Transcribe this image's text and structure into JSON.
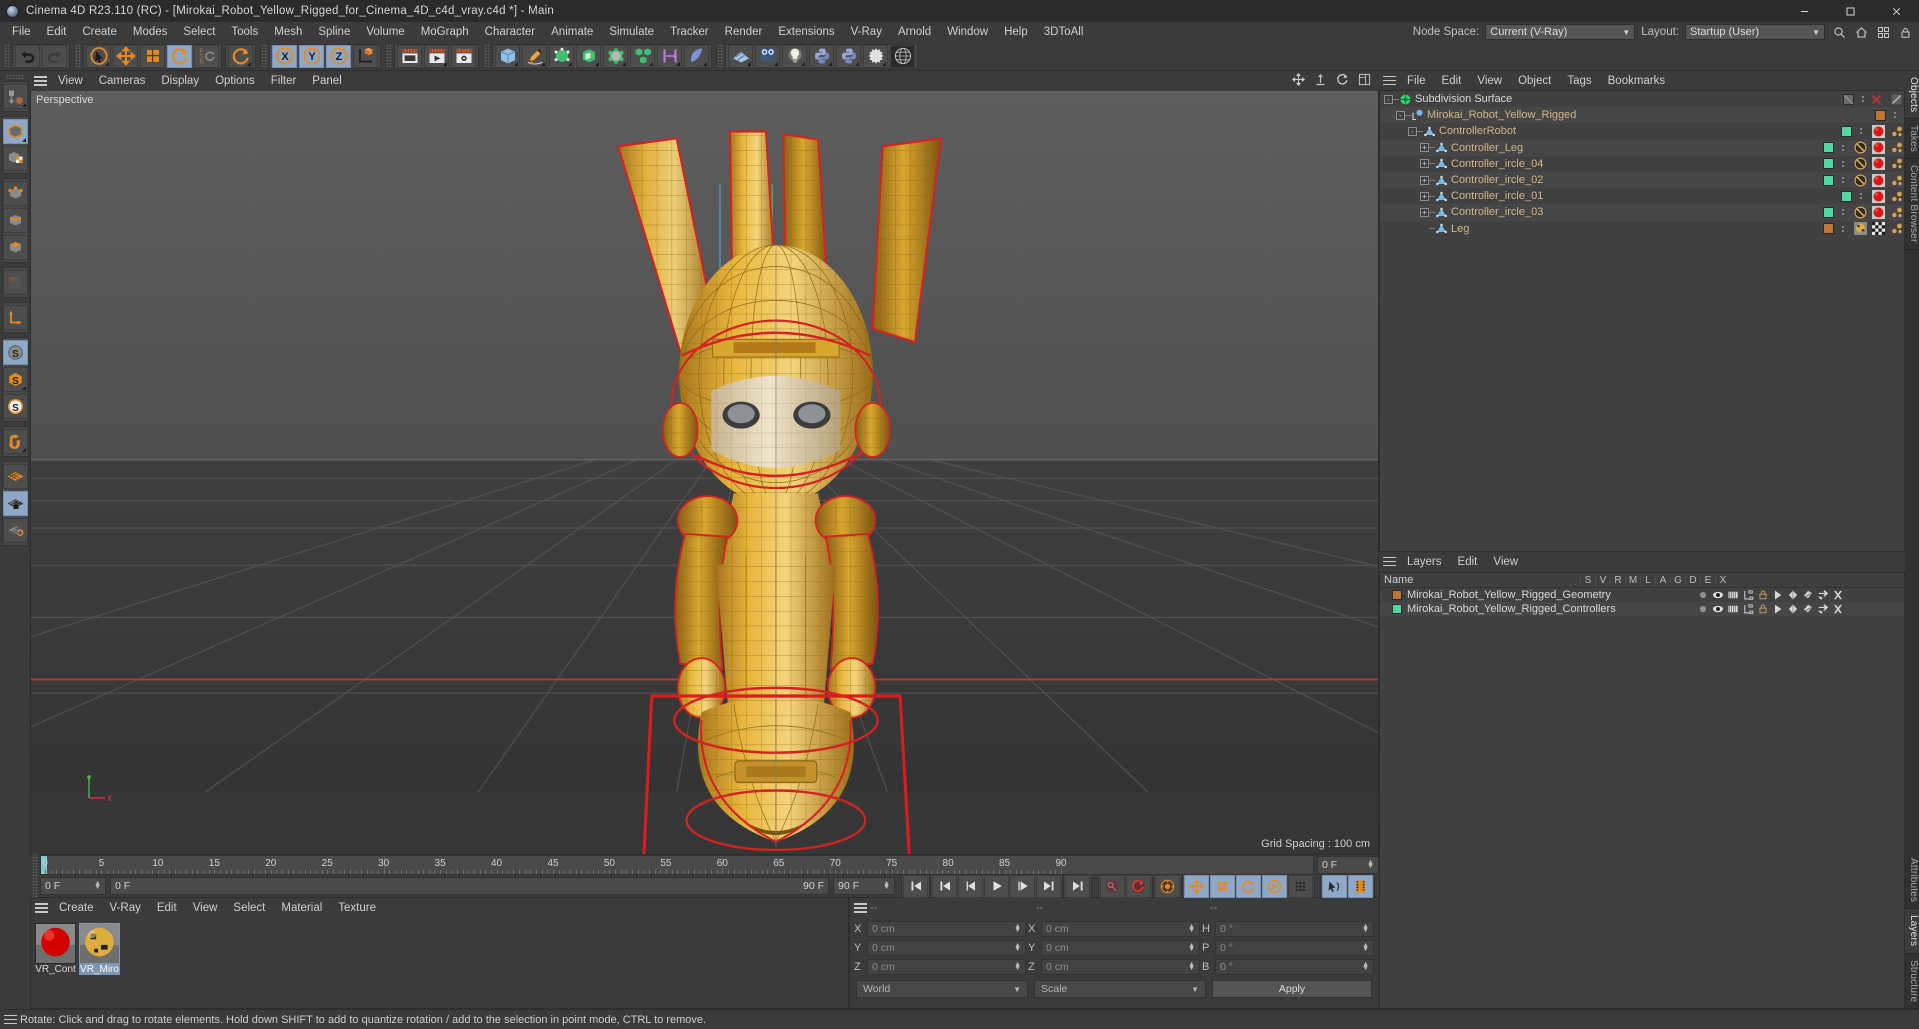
{
  "window": {
    "title": "Cinema 4D R23.110 (RC) - [Mirokai_Robot_Yellow_Rigged_for_Cinema_4D_c4d_vray.c4d *] - Main",
    "minimize": "–",
    "maximize": "▢",
    "close": "✕"
  },
  "menubar": {
    "items": [
      "File",
      "Edit",
      "Create",
      "Modes",
      "Select",
      "Tools",
      "Mesh",
      "Spline",
      "Volume",
      "MoGraph",
      "Character",
      "Animate",
      "Simulate",
      "Tracker",
      "Render",
      "Extensions",
      "V-Ray",
      "Arnold",
      "Window",
      "Help",
      "3DToAll"
    ],
    "node_space_label": "Node Space:",
    "node_space_value": "Current (V-Ray)",
    "layout_label": "Layout:",
    "layout_value": "Startup (User)",
    "search_icon": "search-icon",
    "home_icon": "home-icon",
    "grid_icon": "grid-icon",
    "lock_icon": "lock-icon"
  },
  "viewport": {
    "menu": [
      "View",
      "Cameras",
      "Display",
      "Options",
      "Filter",
      "Panel"
    ],
    "label": "Perspective",
    "grid_spacing": "Grid Spacing : 100 cm",
    "axis_x": "X",
    "axis_y": "Y",
    "tools": [
      "move-view-icon",
      "pan-view-icon",
      "rotate-view-icon",
      "maximize-view-icon"
    ]
  },
  "timeline": {
    "ticks": [
      0,
      5,
      10,
      15,
      20,
      25,
      30,
      35,
      40,
      45,
      50,
      55,
      60,
      65,
      70,
      75,
      80,
      85,
      90
    ],
    "current_frame_field": "0 F",
    "start_field": "0 F",
    "range_start": "0 F",
    "range_end": "90 F",
    "end_field": "90 F",
    "preview_min": "0 F",
    "preview_max": "90 F",
    "transport": [
      "go-to-start-icon",
      "prev-key-icon",
      "prev-frame-icon",
      "play-icon",
      "next-frame-icon",
      "next-key-icon",
      "go-to-end-icon"
    ],
    "record_tools": [
      "autokey-icon",
      "record-icon",
      "keyframe-settings-icon",
      "position-key-icon",
      "scale-key-icon",
      "rotation-key-icon",
      "param-key-icon",
      "point-key-icon"
    ],
    "right_tools": [
      "sound-icon",
      "timeline-icon"
    ]
  },
  "material_manager": {
    "menu": [
      "Create",
      "V-Ray",
      "Edit",
      "View",
      "Select",
      "Material",
      "Texture"
    ],
    "materials": [
      {
        "name": "VR_Cont",
        "color": "#d40000",
        "selected": false
      },
      {
        "name": "VR_Miro",
        "color": "#d8a838",
        "selected": true
      }
    ]
  },
  "coordinates": {
    "header": [
      "--",
      "--",
      "--"
    ],
    "rows": [
      {
        "label1": "X",
        "value1": "0 cm",
        "label2": "X",
        "value2": "0 cm",
        "label3": "H",
        "value3": "0 °"
      },
      {
        "label1": "Y",
        "value1": "0 cm",
        "label2": "Y",
        "value2": "0 cm",
        "label3": "P",
        "value3": "0 °"
      },
      {
        "label1": "Z",
        "value1": "0 cm",
        "label2": "Z",
        "value2": "0 cm",
        "label3": "B",
        "value3": "0 °"
      }
    ],
    "world_select": "World",
    "scale_select": "Scale",
    "apply_button": "Apply"
  },
  "object_manager": {
    "menu": [
      "File",
      "Edit",
      "View",
      "Object",
      "Tags",
      "Bookmarks"
    ],
    "items": [
      {
        "name": "Subdivision Surface",
        "depth": 0,
        "expander": "-",
        "icon": "subdivision-surface-icon",
        "chip": "",
        "dots": true,
        "tags": [
          "disabled-slash-icon"
        ],
        "x": true
      },
      {
        "name": "Mirokai_Robot_Yellow_Rigged",
        "depth": 1,
        "expander": "-",
        "icon": "null-object-icon",
        "chip": "#c07434",
        "dots": true,
        "tags": []
      },
      {
        "name": "ControllerRobot",
        "depth": 2,
        "expander": "-",
        "icon": "joint-icon",
        "chip": "#4fd9a0",
        "dots": true,
        "tags": [
          "red-sphere-icon",
          "xpresso-icon"
        ]
      },
      {
        "name": "Controller_Leg",
        "depth": 3,
        "expander": "+",
        "icon": "joint-icon",
        "chip": "#4fd9a0",
        "dots": true,
        "tags": [
          "no-icon",
          "red-sphere-icon",
          "xpresso-icon"
        ]
      },
      {
        "name": "Controller_ircle_04",
        "depth": 3,
        "expander": "+",
        "icon": "joint-icon",
        "chip": "#4fd9a0",
        "dots": true,
        "tags": [
          "no-icon",
          "red-sphere-icon",
          "xpresso-icon"
        ]
      },
      {
        "name": "Controller_ircle_02",
        "depth": 3,
        "expander": "+",
        "icon": "joint-icon",
        "chip": "#4fd9a0",
        "dots": true,
        "tags": [
          "no-icon",
          "red-sphere-icon",
          "xpresso-icon"
        ]
      },
      {
        "name": "Controller_ircle_01",
        "depth": 3,
        "expander": "+",
        "icon": "joint-icon",
        "chip": "#4fd9a0",
        "dots": true,
        "tags": [
          "red-sphere-icon",
          "xpresso-icon"
        ]
      },
      {
        "name": "Controller_ircle_03",
        "depth": 3,
        "expander": "+",
        "icon": "joint-icon",
        "chip": "#4fd9a0",
        "dots": true,
        "tags": [
          "no-icon",
          "red-sphere-icon",
          "xpresso-icon"
        ]
      },
      {
        "name": "Leg",
        "depth": 3,
        "expander": "",
        "icon": "joint-icon",
        "chip": "#c07434",
        "dots": true,
        "tags": [
          "material-icon",
          "uv-icon",
          "xpresso-icon"
        ]
      }
    ]
  },
  "layer_manager": {
    "menu": [
      "Layers",
      "Edit",
      "View"
    ],
    "name_column": "Name",
    "columns": [
      "S",
      "V",
      "R",
      "M",
      "L",
      "A",
      "G",
      "D",
      "E",
      "X"
    ],
    "rows": [
      {
        "name": "Mirokai_Robot_Yellow_Rigged_Geometry",
        "color": "#c07434"
      },
      {
        "name": "Mirokai_Robot_Yellow_Rigged_Controllers",
        "color": "#4fd9a0"
      }
    ]
  },
  "right_tabs": {
    "top": [
      "Objects",
      "Takes",
      "Content Browser"
    ],
    "bottom": [
      "Attributes",
      "Layers",
      "Structure"
    ],
    "active_top": "Objects",
    "active_bottom": "Layers"
  },
  "statusbar": {
    "text": "Rotate: Click and drag to rotate elements. Hold down SHIFT to add to quantize rotation / add to the selection in point mode, CTRL to remove."
  },
  "colors": {
    "accent_orange": "#e38a21",
    "selection_blue": "#8fa8c8",
    "rig_red": "#e01b1b",
    "robot_yellow": "#e8b63c",
    "panel_bg": "#3b3b3b"
  }
}
